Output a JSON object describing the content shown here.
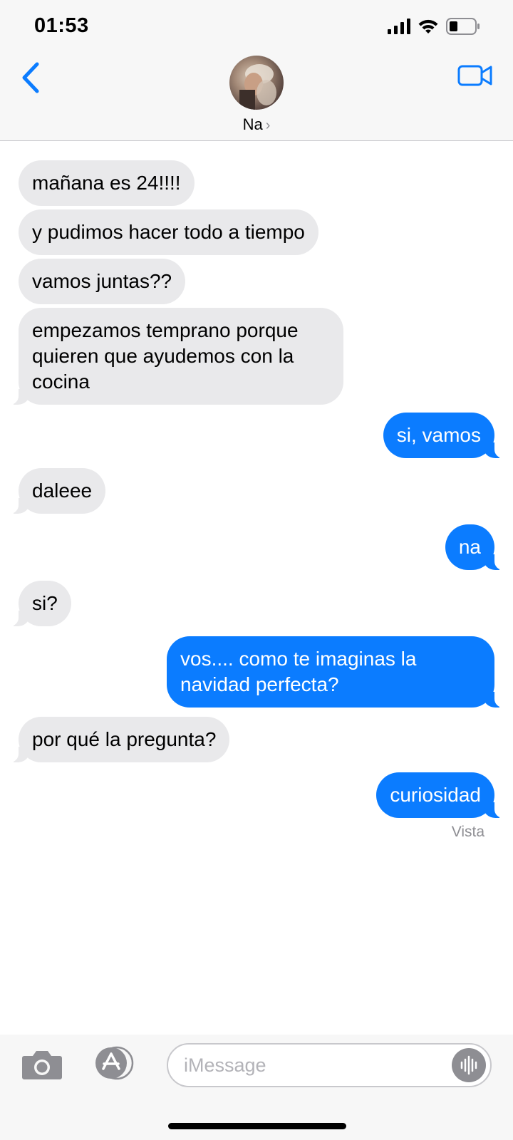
{
  "status": {
    "time": "01:53",
    "icons": [
      "cellular-signal-icon",
      "wifi-icon",
      "battery-icon"
    ]
  },
  "header": {
    "contact_name": "Na",
    "chevron": "›",
    "back_icon": "chevron-left-icon",
    "video_icon": "video-camera-icon"
  },
  "messages": [
    {
      "dir": "in",
      "text": "mañana es 24!!!!"
    },
    {
      "dir": "in",
      "text": "y pudimos hacer todo a tiempo"
    },
    {
      "dir": "in",
      "text": "vamos juntas??"
    },
    {
      "dir": "in",
      "text": "empezamos temprano porque quieren que ayudemos con la cocina"
    },
    {
      "dir": "out",
      "text": "si, vamos"
    },
    {
      "dir": "in",
      "text": "daleee"
    },
    {
      "dir": "out",
      "text": "na"
    },
    {
      "dir": "in",
      "text": "si?"
    },
    {
      "dir": "out",
      "text": "vos.... como te imaginas la navidad perfecta?"
    },
    {
      "dir": "in",
      "text": "por qué la pregunta?"
    },
    {
      "dir": "out",
      "text": "curiosidad"
    }
  ],
  "read_receipt": "Vista",
  "composer": {
    "placeholder": "iMessage",
    "camera_icon": "camera-icon",
    "apps_icon": "app-store-icon",
    "audio_icon": "audio-waveform-icon"
  },
  "colors": {
    "incoming_bubble": "#e9e9eb",
    "outgoing_bubble": "#0b7cff",
    "accent": "#0b7cff"
  }
}
